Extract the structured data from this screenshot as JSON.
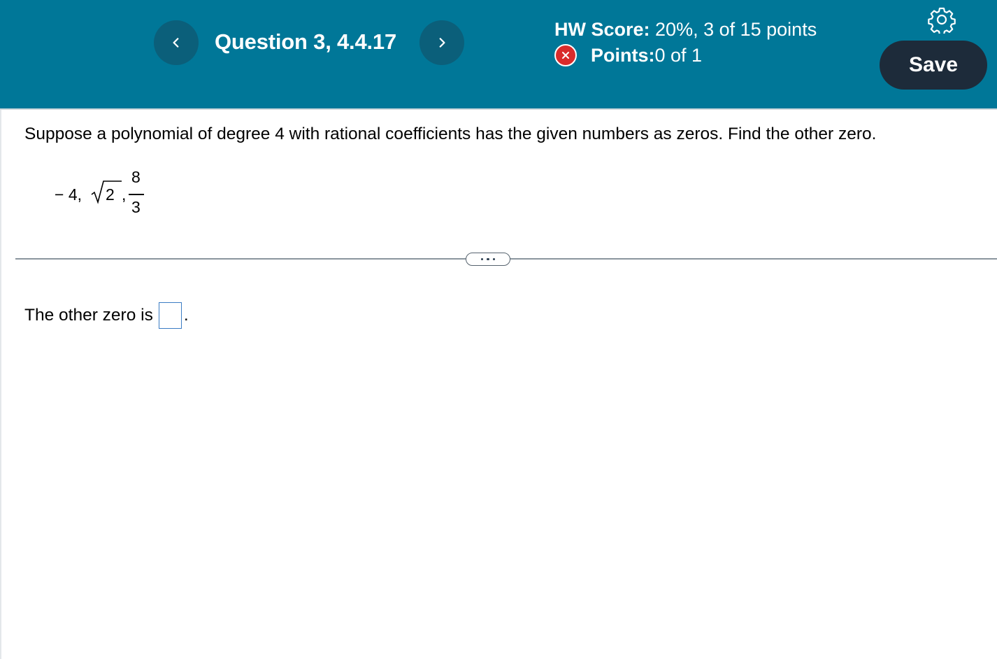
{
  "header": {
    "question_title": "Question 3, 4.4.17",
    "hw_score_label": "HW Score:",
    "hw_score_value": " 20%, 3 of 15 points",
    "points_label": "Points:",
    "points_value": " 0 of 1",
    "save_label": "Save",
    "status_icon": "x-circle-icon",
    "settings_icon": "gear-icon"
  },
  "question": {
    "prompt": "Suppose a polynomial of degree 4 with rational coefficients has the given numbers as zeros. Find the other zero.",
    "zeros": {
      "neg_four": "− 4,",
      "sqrt_radicand": "2",
      "comma": ",",
      "frac_numerator": "8",
      "frac_denominator": "3"
    },
    "answer_prefix": "The other zero is",
    "answer_suffix": ".",
    "answer_value": ""
  },
  "colors": {
    "header_bg": "#007798",
    "nav_button_bg": "#0b5f7a",
    "save_button_bg": "#1d2b3a",
    "incorrect_badge": "#d92b2b",
    "answer_box_border": "#3b7cc4"
  }
}
